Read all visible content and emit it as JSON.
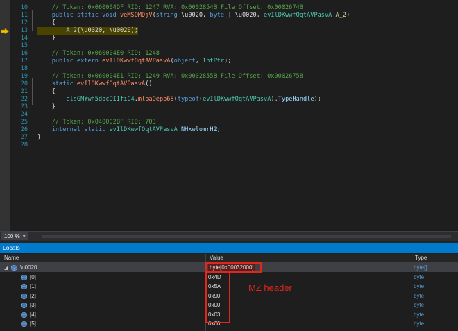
{
  "editor": {
    "lines": [
      {
        "num": "10",
        "segments": [
          {
            "t": "    // Token: 0x060004DF RID: 1247 RVA: 0x00028548 File Offset: 0x00026748",
            "c": "com"
          }
        ]
      },
      {
        "num": "11",
        "segments": [
          {
            "t": "    public static void ",
            "c": "kw"
          },
          {
            "t": "veMSOMDjV",
            "c": "meth"
          },
          {
            "t": "(",
            "c": "plain"
          },
          {
            "t": "string",
            "c": "kw"
          },
          {
            "t": " \\u0020, ",
            "c": "plain"
          },
          {
            "t": "byte",
            "c": "kw"
          },
          {
            "t": "[] \\u0020, ",
            "c": "plain"
          },
          {
            "t": "evIlDKwwfOqtAVPasvA",
            "c": "typ"
          },
          {
            "t": " ",
            "c": "plain"
          },
          {
            "t": "A_2",
            "c": "mint"
          },
          {
            "t": ")",
            "c": "plain"
          }
        ]
      },
      {
        "num": "12",
        "segments": [
          {
            "t": "    {",
            "c": "plain"
          }
        ]
      },
      {
        "num": "13",
        "current": true,
        "segments": [
          {
            "t": "        ",
            "c": "plain"
          },
          {
            "t": "A_2",
            "c": "param"
          },
          {
            "t": "(\\u0020, \\u0020);",
            "c": "plain"
          }
        ]
      },
      {
        "num": "14",
        "segments": [
          {
            "t": "    }",
            "c": "plain"
          }
        ]
      },
      {
        "num": "15",
        "segments": []
      },
      {
        "num": "16",
        "segments": [
          {
            "t": "    // Token: 0x060004E0 RID: 1248",
            "c": "com"
          }
        ]
      },
      {
        "num": "17",
        "segments": [
          {
            "t": "    public extern ",
            "c": "kw"
          },
          {
            "t": "evIlDKwwfOqtAVPasvA",
            "c": "meth"
          },
          {
            "t": "(",
            "c": "plain"
          },
          {
            "t": "object",
            "c": "kw"
          },
          {
            "t": ", ",
            "c": "plain"
          },
          {
            "t": "IntPtr",
            "c": "typ"
          },
          {
            "t": ");",
            "c": "plain"
          }
        ]
      },
      {
        "num": "18",
        "segments": []
      },
      {
        "num": "19",
        "segments": [
          {
            "t": "    // Token: 0x060004E1 RID: 1249 RVA: 0x00028558 File Offset: 0x00026758",
            "c": "com"
          }
        ]
      },
      {
        "num": "20",
        "segments": [
          {
            "t": "    static ",
            "c": "kw"
          },
          {
            "t": "evIlDKwwfOqtAVPasvA",
            "c": "meth"
          },
          {
            "t": "()",
            "c": "plain"
          }
        ]
      },
      {
        "num": "21",
        "segments": [
          {
            "t": "    {",
            "c": "plain"
          }
        ]
      },
      {
        "num": "22",
        "segments": [
          {
            "t": "        ",
            "c": "plain"
          },
          {
            "t": "elsGMYwh5docOIIfiC4",
            "c": "typ"
          },
          {
            "t": ".",
            "c": "plain"
          },
          {
            "t": "mloaQepp68",
            "c": "meth"
          },
          {
            "t": "(",
            "c": "plain"
          },
          {
            "t": "typeof",
            "c": "kw"
          },
          {
            "t": "(",
            "c": "plain"
          },
          {
            "t": "evIlDKwwfOqtAVPasvA",
            "c": "typ"
          },
          {
            "t": ").",
            "c": "plain"
          },
          {
            "t": "TypeHandle",
            "c": "param"
          },
          {
            "t": ");",
            "c": "plain"
          }
        ]
      },
      {
        "num": "23",
        "segments": [
          {
            "t": "    }",
            "c": "plain"
          }
        ]
      },
      {
        "num": "24",
        "segments": []
      },
      {
        "num": "25",
        "segments": [
          {
            "t": "    // Token: 0x040002BF RID: 703",
            "c": "com"
          }
        ]
      },
      {
        "num": "26",
        "segments": [
          {
            "t": "    internal static ",
            "c": "kw"
          },
          {
            "t": "evIlDKwwfOqtAVPasvA",
            "c": "typ"
          },
          {
            "t": " ",
            "c": "plain"
          },
          {
            "t": "NHxwlomrH2",
            "c": "param"
          },
          {
            "t": ";",
            "c": "plain"
          }
        ]
      },
      {
        "num": "27",
        "segments": [
          {
            "t": "}",
            "c": "plain"
          }
        ]
      },
      {
        "num": "28",
        "segments": []
      }
    ]
  },
  "statusbar": {
    "zoom": "100 %",
    "zoom_arrow": "▾"
  },
  "locals": {
    "title": "Locals",
    "columns": {
      "name": "Name",
      "value": "Value",
      "type": "Type"
    },
    "rows": [
      {
        "name": "\\u0020",
        "value": "byte[0x00032000]",
        "type": "byte[]",
        "expanded": true,
        "selected": true
      },
      {
        "name": "[0]",
        "value": "0x4D",
        "type": "byte"
      },
      {
        "name": "[1]",
        "value": "0x5A",
        "type": "byte"
      },
      {
        "name": "[2]",
        "value": "0x90",
        "type": "byte"
      },
      {
        "name": "[3]",
        "value": "0x00",
        "type": "byte"
      },
      {
        "name": "[4]",
        "value": "0x03",
        "type": "byte"
      },
      {
        "name": "[5]",
        "value": "0x00",
        "type": "byte"
      }
    ],
    "expand_glyph": "◢"
  },
  "annotation": {
    "label": "MZ header",
    "color": "#e0271c"
  },
  "icons": {
    "current_line_arrow": "arrow-right-icon",
    "variable_icon": "cube-icon"
  },
  "colors": {
    "accent": "#007acc",
    "highlight": "#e0271c"
  }
}
